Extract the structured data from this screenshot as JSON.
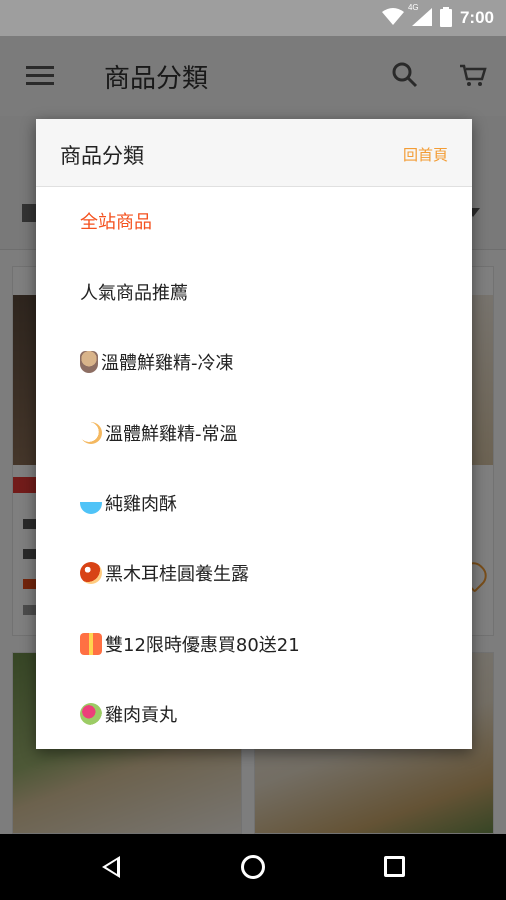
{
  "status_bar": {
    "time": "7:00",
    "network": "4G",
    "icons": [
      "wifi-icon",
      "cellular-signal-icon",
      "battery-icon"
    ]
  },
  "app_bar": {
    "title": "商品分類",
    "icons": [
      "menu-icon",
      "search-icon",
      "cart-icon"
    ]
  },
  "dialog": {
    "title": "商品分類",
    "home_link": "回首頁",
    "items": [
      {
        "label": "全站商品",
        "icon": "",
        "active": true
      },
      {
        "label": "人氣商品推薦",
        "icon": "",
        "active": false
      },
      {
        "label": "溫體鮮雞精-冷凍",
        "icon": "bottle-emoji",
        "active": false
      },
      {
        "label": "溫體鮮雞精-常溫",
        "icon": "chick-emoji",
        "active": false
      },
      {
        "label": "純雞肉酥",
        "icon": "rice-bowl-emoji",
        "active": false
      },
      {
        "label": "黑木耳桂圓養生露",
        "icon": "mushroom-emoji",
        "active": false
      },
      {
        "label": "雙12限時優惠買80送21",
        "icon": "gift-emoji",
        "active": false
      },
      {
        "label": "雞肉貢丸",
        "icon": "dango-emoji",
        "active": false
      }
    ]
  },
  "colors": {
    "accent_orange": "#f39c34",
    "active_red": "#f4511e",
    "status_bar": "#9e9e9e"
  },
  "nav_bar": {
    "icons": [
      "back-icon",
      "home-icon",
      "recents-icon"
    ]
  }
}
